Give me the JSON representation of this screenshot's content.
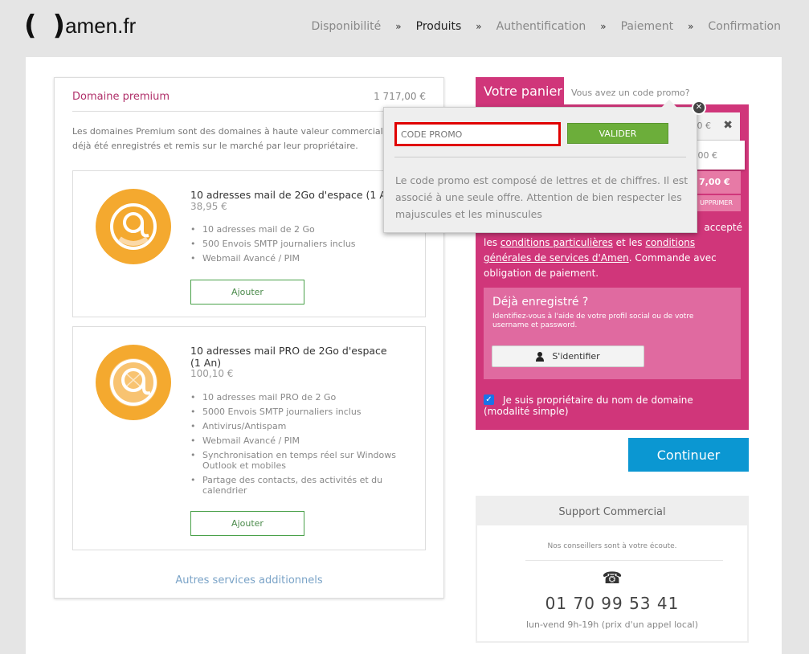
{
  "logo": {
    "left_paren": "(",
    "right_paren": ")",
    "text": "amen.fr"
  },
  "steps": [
    {
      "label": "Disponibilité"
    },
    {
      "label": "Produits"
    },
    {
      "label": "Authentification"
    },
    {
      "label": "Paiement"
    },
    {
      "label": "Confirmation"
    }
  ],
  "steps_separator": "»",
  "domain_premium": {
    "title": "Domaine premium",
    "price": "1 717,00 €",
    "description_line1": "Les domaines Premium sont des domaines à haute valeur commerciale",
    "description_line2": "déjà été enregistrés et remis sur le marché par leur propriétaire."
  },
  "offers": [
    {
      "title": "10 adresses mail de 2Go d'espace (1 An)",
      "price": "38,95 €",
      "features": [
        "10 adresses mail de 2 Go",
        "500 Envois SMTP journaliers inclus",
        "Webmail Avancé / PIM"
      ],
      "button": "Ajouter"
    },
    {
      "title_line1": "10 adresses mail PRO de 2Go d'espace",
      "title_line2": "(1 An)",
      "price": "100,10 €",
      "features": [
        "10 adresses mail PRO de 2 Go",
        "5000 Envois SMTP journaliers inclus",
        "Antivirus/Antispam",
        "Webmail Avancé / PIM",
        "Synchronisation en temps réel sur Windows Outlook et mobiles",
        "Partage des contacts, des activités et du calendrier"
      ],
      "button": "Ajouter"
    }
  ],
  "autres_link": "Autres services additionnels",
  "panier": {
    "tab": "Votre panier",
    "promo_link": "Vous avez un code promo?",
    "line1_price": "0 €",
    "line1_remove": "✖",
    "line2_price": "00 €",
    "total": "7,00 €",
    "delete": "UPPRIMER",
    "accept_line1": "accepté",
    "accept_pre": "les ",
    "accept_link1": "conditions particulières",
    "accept_mid": " et les ",
    "accept_link2": "conditions générales de services d'Amen",
    "accept_post": ". Commande avec obligation de paiement."
  },
  "deja": {
    "title": "Déjà enregistré ?",
    "desc": "Identifiez-vous à l'aide de votre profil social ou de votre username et password.",
    "button": "S'identifier"
  },
  "owner": {
    "checkmark": "✓",
    "text": "Je suis propriétaire du nom de domaine (modalité simple)"
  },
  "continuer": "Continuer",
  "support": {
    "title": "Support Commercial",
    "subtitle": "Nos conseillers sont à votre écoute.",
    "phone_icon": "☎",
    "phone": "01 70 99 53 41",
    "hours": "lun-vend 9h-19h (prix d'un appel local)"
  },
  "popover": {
    "close": "✕",
    "placeholder": "CODE PROMO",
    "button": "VALIDER",
    "info": "Le code promo est composé de lettres et de chiffres. Il est associé à une seule offre. Attention de bien respecter les majuscules et les minuscules"
  },
  "colors": {
    "brand": "#d0367a",
    "accent_blue": "#0b97d2",
    "ok_green": "#6cae3a",
    "icon_orange": "#f4a92f"
  }
}
